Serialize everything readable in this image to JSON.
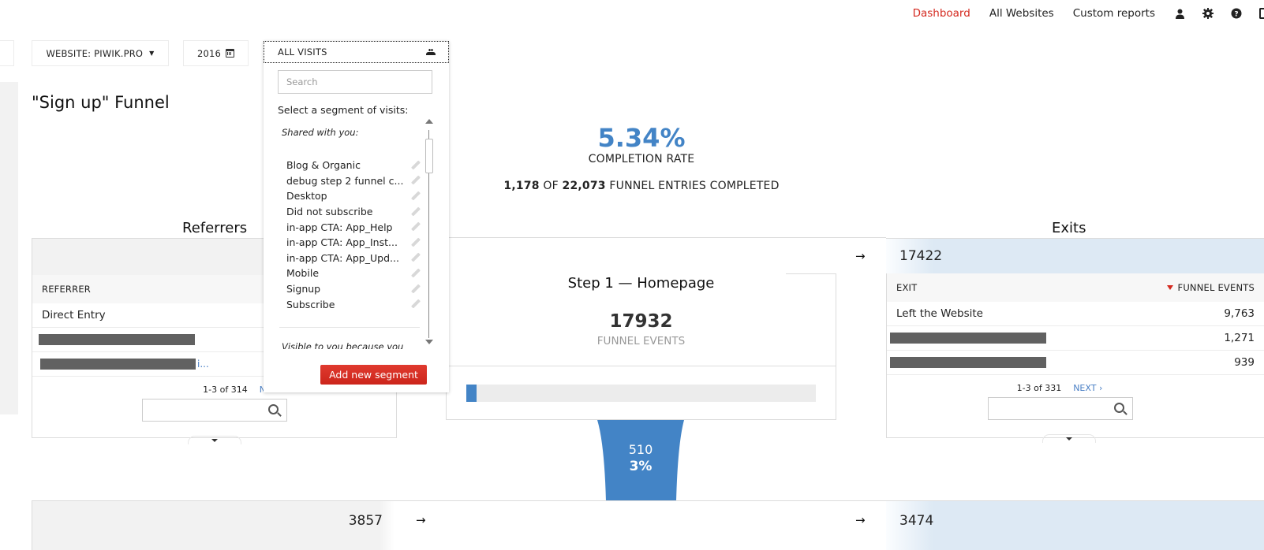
{
  "topnav": {
    "links": [
      {
        "label": "Dashboard",
        "active": true
      },
      {
        "label": "All Websites",
        "active": false
      },
      {
        "label": "Custom reports",
        "active": false
      }
    ],
    "icons": [
      "user-icon",
      "gear-icon",
      "help-icon",
      "more-icon"
    ]
  },
  "selectors": {
    "website": "WEBSITE: PIWIK.PRO",
    "date": "2016",
    "segment": "ALL VISITS"
  },
  "page": {
    "title": "\"Sign up\" Funnel"
  },
  "completion": {
    "rate": "5.34%",
    "rate_label": "COMPLETION RATE",
    "completed": "1,178",
    "of_word": "OF",
    "entries": "22,073",
    "entries_suffix": "FUNNEL ENTRIES COMPLETED"
  },
  "referrers": {
    "title": "Referrers",
    "column": "REFERRER",
    "rows": [
      {
        "label": "Direct Entry",
        "redacted": false
      },
      {
        "label": "",
        "redacted": true
      },
      {
        "label": "",
        "redacted": true,
        "tail": "i..."
      }
    ],
    "pager": "1-3 of 314",
    "next": "NEXT ›",
    "bottom_value": "3857"
  },
  "exits": {
    "title": "Exits",
    "band_value": "17422",
    "columns": {
      "exit": "EXIT",
      "events": "FUNNEL EVENTS"
    },
    "rows": [
      {
        "label": "Left the Website",
        "value": "9,763",
        "redacted": false
      },
      {
        "label": "",
        "value": "1,271",
        "redacted": true
      },
      {
        "label": "",
        "value": "939",
        "redacted": true
      }
    ],
    "pager": "1-3 of 331",
    "next": "NEXT ›",
    "bottom_value": "3474"
  },
  "step": {
    "title": "Step 1 — Homepage",
    "count": "17932",
    "count_label": "FUNNEL EVENTS",
    "progress_fraction": 0.03,
    "arrow": "→"
  },
  "transition": {
    "count": "510",
    "percent": "3%"
  },
  "segment_dropdown": {
    "search_placeholder": "Search",
    "prompt": "Select a segment of visits:",
    "shared_heading": "Shared with you:",
    "items": [
      "Blog & Organic",
      "debug step 2 funnel c...",
      "Desktop",
      "Did not subscribe",
      "in-app CTA: App_Help",
      "in-app CTA: App_Inst...",
      "in-app CTA: App_Upd...",
      "Mobile",
      "Signup",
      "Subscribe"
    ],
    "visible_note": "Visible to you because you",
    "add_button": "Add new segment"
  },
  "colors": {
    "accent_blue": "#4384c6",
    "active_red": "#d4291f",
    "button_red": "#d72d22",
    "exit_band": "#dde9f4"
  }
}
